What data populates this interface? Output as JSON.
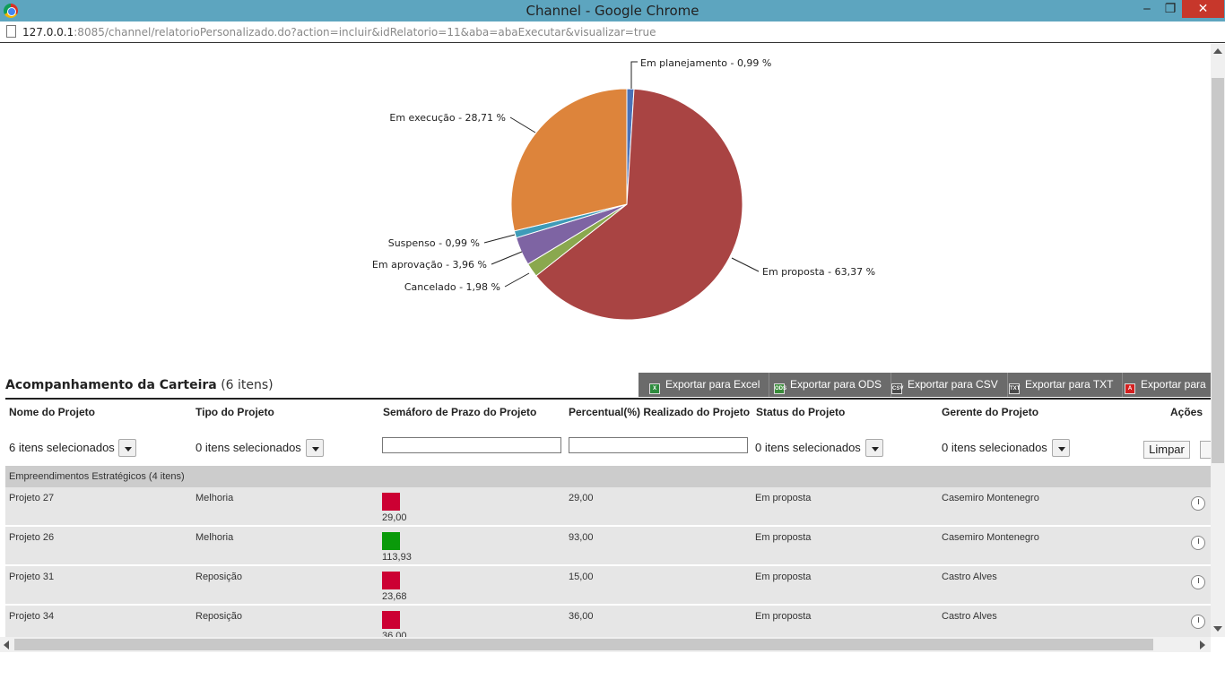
{
  "window": {
    "title": "Channel - Google Chrome",
    "min": "‒",
    "max": "❐",
    "close": "✕"
  },
  "address": {
    "host": "127.0.0.1",
    "rest": ":8085/channel/relatorioPersonalizado.do?action=incluir&idRelatorio=11&aba=abaExecutar&visualizar=true"
  },
  "chart_data": {
    "type": "pie",
    "title": "",
    "slices": [
      {
        "label": "Em planejamento - 0,99 %",
        "value": 0.99,
        "color": "#4a72b8"
      },
      {
        "label": "Em proposta - 63,37 %",
        "value": 63.37,
        "color": "#a94443"
      },
      {
        "label": "Cancelado - 1,98 %",
        "value": 1.98,
        "color": "#8aa84e"
      },
      {
        "label": "Em aprovação - 3,96 %",
        "value": 3.96,
        "color": "#7e64a3"
      },
      {
        "label": "Suspenso - 0,99 %",
        "value": 0.99,
        "color": "#3e9bb8"
      },
      {
        "label": "Em execução - 28,71 %",
        "value": 28.71,
        "color": "#dd843b"
      }
    ]
  },
  "section": {
    "title": "Acompanhamento da Carteira",
    "count": "(6 itens)"
  },
  "exports": [
    {
      "label": "Exportar para Excel",
      "icon": "excel-icon",
      "glyph": "X",
      "cls": "xls"
    },
    {
      "label": "Exportar para ODS",
      "icon": "ods-icon",
      "glyph": "ODS",
      "cls": "ods"
    },
    {
      "label": "Exportar para CSV",
      "icon": "csv-icon",
      "glyph": "CSV",
      "cls": "csv"
    },
    {
      "label": "Exportar para TXT",
      "icon": "txt-icon",
      "glyph": "TXT",
      "cls": "txt"
    },
    {
      "label": "Exportar para",
      "icon": "pdf-icon",
      "glyph": "A",
      "cls": "pdf"
    }
  ],
  "columns": [
    "Nome do Projeto",
    "Tipo do Projeto",
    "Semáforo de Prazo do Projeto",
    "Percentual(%) Realizado do Projeto",
    "Status do Projeto",
    "Gerente do Projeto",
    "Ações"
  ],
  "filters": {
    "nome": "6 itens selecionados",
    "tipo": "0 itens selecionados",
    "semaforo": "",
    "percentual": "",
    "status": "0 itens selecionados",
    "gerente": "0 itens selecionados",
    "limpar": "Limpar"
  },
  "group": {
    "label": "Empreendimentos Estratégicos (4 itens)"
  },
  "rows": [
    {
      "nome": "Projeto 27",
      "tipo": "Melhoria",
      "semaforo_color": "#cc0033",
      "semaforo_value": "29,00",
      "percentual": "29,00",
      "status": "Em proposta",
      "gerente": "Casemiro Montenegro"
    },
    {
      "nome": "Projeto 26",
      "tipo": "Melhoria",
      "semaforo_color": "#0a9a0a",
      "semaforo_value": "113,93",
      "percentual": "93,00",
      "status": "Em proposta",
      "gerente": "Casemiro Montenegro"
    },
    {
      "nome": "Projeto 31",
      "tipo": "Reposição",
      "semaforo_color": "#cc0033",
      "semaforo_value": "23,68",
      "percentual": "15,00",
      "status": "Em proposta",
      "gerente": "Castro Alves"
    },
    {
      "nome": "Projeto 34",
      "tipo": "Reposição",
      "semaforo_color": "#cc0033",
      "semaforo_value": "36,00",
      "percentual": "36,00",
      "status": "Em proposta",
      "gerente": "Castro Alves"
    }
  ]
}
